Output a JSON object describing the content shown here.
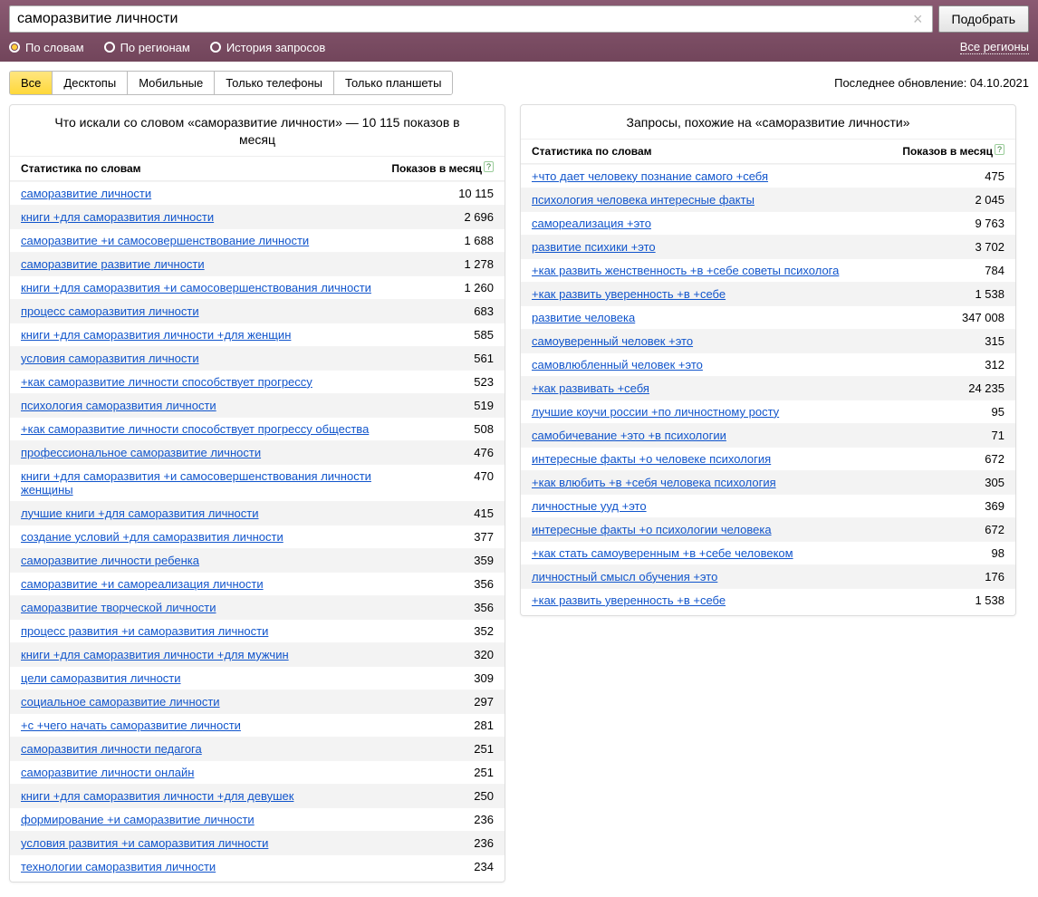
{
  "header": {
    "search_value": "саморазвитие личности",
    "search_placeholder": "",
    "pick_button": "Подобрать",
    "radios": {
      "by_words": "По словам",
      "by_regions": "По регионам",
      "history": "История запросов"
    },
    "all_regions": "Все регионы"
  },
  "toolbar": {
    "tabs": [
      "Все",
      "Десктопы",
      "Мобильные",
      "Только телефоны",
      "Только планшеты"
    ],
    "update_label": "Последнее обновление: 04.10.2021"
  },
  "columns": {
    "stats_header": "Статистика по словам",
    "shows_header": "Показов в месяц"
  },
  "left": {
    "title": "Что искали со словом «саморазвитие личности» — 10 115 показов в месяц",
    "rows": [
      {
        "q": "саморазвитие личности",
        "n": "10 115"
      },
      {
        "q": "книги +для саморазвития личности",
        "n": "2 696"
      },
      {
        "q": "саморазвитие +и самосовершенствование личности",
        "n": "1 688"
      },
      {
        "q": "саморазвитие развитие личности",
        "n": "1 278"
      },
      {
        "q": "книги +для саморазвития +и самосовершенствования личности",
        "n": "1 260"
      },
      {
        "q": "процесс саморазвития личности",
        "n": "683"
      },
      {
        "q": "книги +для саморазвития личности +для женщин",
        "n": "585"
      },
      {
        "q": "условия саморазвития личности",
        "n": "561"
      },
      {
        "q": "+как саморазвитие личности способствует прогрессу",
        "n": "523"
      },
      {
        "q": "психология саморазвития личности",
        "n": "519"
      },
      {
        "q": "+как саморазвитие личности способствует прогрессу общества",
        "n": "508"
      },
      {
        "q": "профессиональное саморазвитие личности",
        "n": "476"
      },
      {
        "q": "книги +для саморазвития +и самосовершенствования личности женщины",
        "n": "470"
      },
      {
        "q": "лучшие книги +для саморазвития личности",
        "n": "415"
      },
      {
        "q": "создание условий +для саморазвития личности",
        "n": "377"
      },
      {
        "q": "саморазвитие личности ребенка",
        "n": "359"
      },
      {
        "q": "саморазвитие +и самореализация личности",
        "n": "356"
      },
      {
        "q": "саморазвитие творческой личности",
        "n": "356"
      },
      {
        "q": "процесс развития +и саморазвития личности",
        "n": "352"
      },
      {
        "q": "книги +для саморазвития личности +для мужчин",
        "n": "320"
      },
      {
        "q": "цели саморазвития личности",
        "n": "309"
      },
      {
        "q": "социальное саморазвитие личности",
        "n": "297"
      },
      {
        "q": "+с +чего начать саморазвитие личности",
        "n": "281"
      },
      {
        "q": "саморазвития личности педагога",
        "n": "251"
      },
      {
        "q": "саморазвитие личности онлайн",
        "n": "251"
      },
      {
        "q": "книги +для саморазвития личности +для девушек",
        "n": "250"
      },
      {
        "q": "формирование +и саморазвитие личности",
        "n": "236"
      },
      {
        "q": "условия развития +и саморазвития личности",
        "n": "236"
      },
      {
        "q": "технологии саморазвития личности",
        "n": "234"
      }
    ]
  },
  "right": {
    "title": "Запросы, похожие на «саморазвитие личности»",
    "rows": [
      {
        "q": "+что дает человеку познание самого +себя",
        "n": "475"
      },
      {
        "q": "психология человека интересные факты",
        "n": "2 045"
      },
      {
        "q": "самореализация +это",
        "n": "9 763"
      },
      {
        "q": "развитие психики +это",
        "n": "3 702"
      },
      {
        "q": "+как развить женственность +в +себе советы психолога",
        "n": "784"
      },
      {
        "q": "+как развить уверенность +в +себе",
        "n": "1 538"
      },
      {
        "q": "развитие человека",
        "n": "347 008"
      },
      {
        "q": "самоуверенный человек +это",
        "n": "315"
      },
      {
        "q": "самовлюбленный человек +это",
        "n": "312"
      },
      {
        "q": "+как развивать +себя",
        "n": "24 235"
      },
      {
        "q": "лучшие коучи россии +по личностному росту",
        "n": "95"
      },
      {
        "q": "самобичевание +это +в психологии",
        "n": "71"
      },
      {
        "q": "интересные факты +о человеке психология",
        "n": "672"
      },
      {
        "q": "+как влюбить +в +себя человека психология",
        "n": "305"
      },
      {
        "q": "личностные ууд +это",
        "n": "369"
      },
      {
        "q": "интересные факты +о психологии человека",
        "n": "672"
      },
      {
        "q": "+как стать самоуверенным +в +себе человеком",
        "n": "98"
      },
      {
        "q": "личностный смысл обучения +это",
        "n": "176"
      },
      {
        "q": "+как развить уверенность +в +себе",
        "n": "1 538"
      }
    ]
  }
}
